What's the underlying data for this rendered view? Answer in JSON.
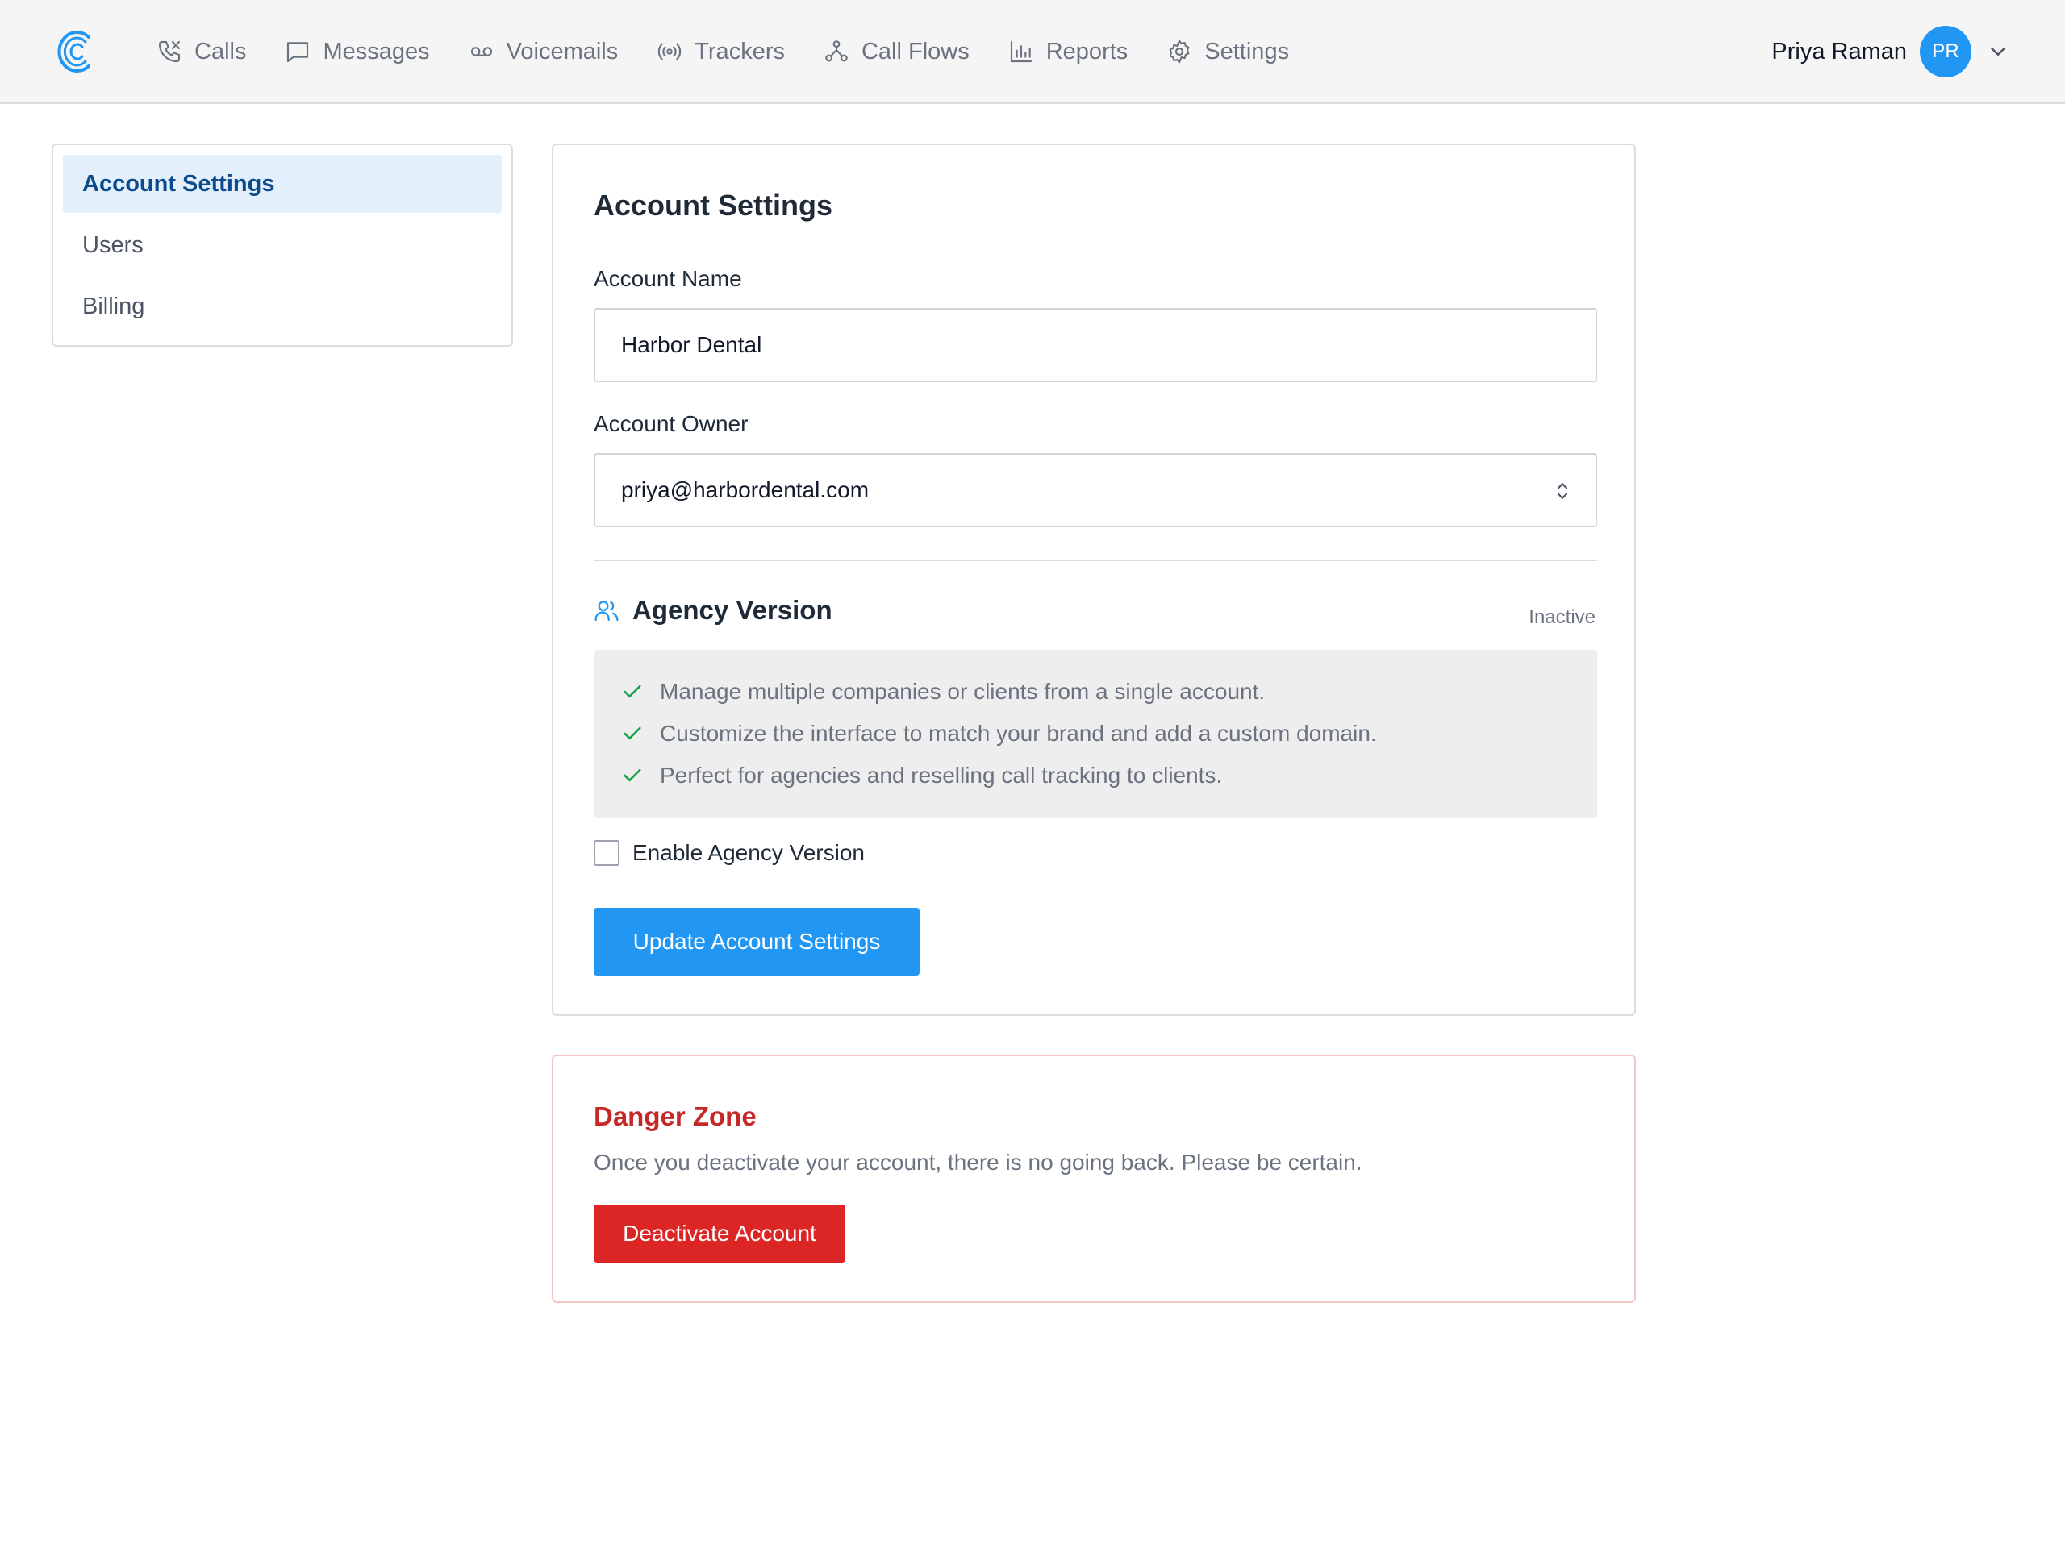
{
  "brand": {
    "logo_icon": "brand-c-logo",
    "accent_color": "#2196f3"
  },
  "nav": [
    {
      "label": "Calls",
      "icon": "phone-icon"
    },
    {
      "label": "Messages",
      "icon": "message-icon"
    },
    {
      "label": "Voicemails",
      "icon": "voicemail-icon"
    },
    {
      "label": "Trackers",
      "icon": "tracker-icon"
    },
    {
      "label": "Call Flows",
      "icon": "call-flow-icon"
    },
    {
      "label": "Reports",
      "icon": "bar-chart-icon"
    },
    {
      "label": "Settings",
      "icon": "gear-icon"
    }
  ],
  "user": {
    "name": "Priya Raman",
    "initials": "PR"
  },
  "sidebar": {
    "items": [
      {
        "label": "Account Settings",
        "active": true
      },
      {
        "label": "Users",
        "active": false
      },
      {
        "label": "Billing",
        "active": false
      }
    ]
  },
  "account": {
    "title": "Account Settings",
    "name_label": "Account Name",
    "name_value": "Harbor Dental",
    "owner_label": "Account Owner",
    "owner_value": "priya@harbordental.com",
    "agency": {
      "title": "Agency Version",
      "status": "Inactive",
      "features": [
        "Manage multiple companies or clients from a single account.",
        "Customize the interface to match your brand and add a custom domain.",
        "Perfect for agencies and reselling call tracking to clients."
      ],
      "checkbox_label": "Enable Agency Version",
      "checked": false
    },
    "submit_label": "Update Account Settings"
  },
  "danger": {
    "title": "Danger Zone",
    "text": "Once you deactivate your account, there is no going back. Please be certain.",
    "button_label": "Deactivate Account",
    "color": "#dc2626"
  }
}
